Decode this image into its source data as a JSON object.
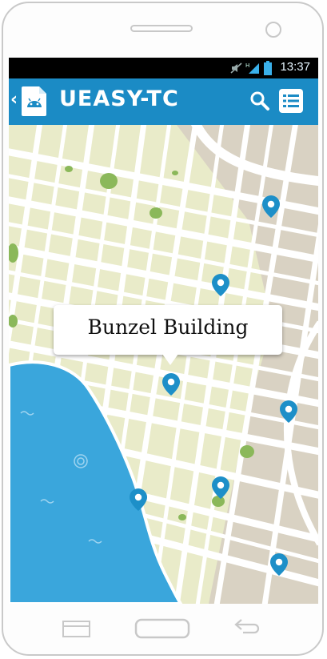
{
  "status_bar": {
    "time": "13:37"
  },
  "app_bar": {
    "back_glyph": "‹",
    "title": "UEASY-TC",
    "icons": [
      "android-app-icon",
      "search-icon",
      "list-menu-icon"
    ]
  },
  "map": {
    "selected_place": "Bunzel Building",
    "colors": {
      "land": "#e9ebc9",
      "road": "#ffffff",
      "water": "#3aa6dc",
      "park": "#8bb85a",
      "urban": "#d9d2c3",
      "pin": "#1d8fc8"
    }
  },
  "colors": {
    "accent": "#1b8bc5"
  }
}
